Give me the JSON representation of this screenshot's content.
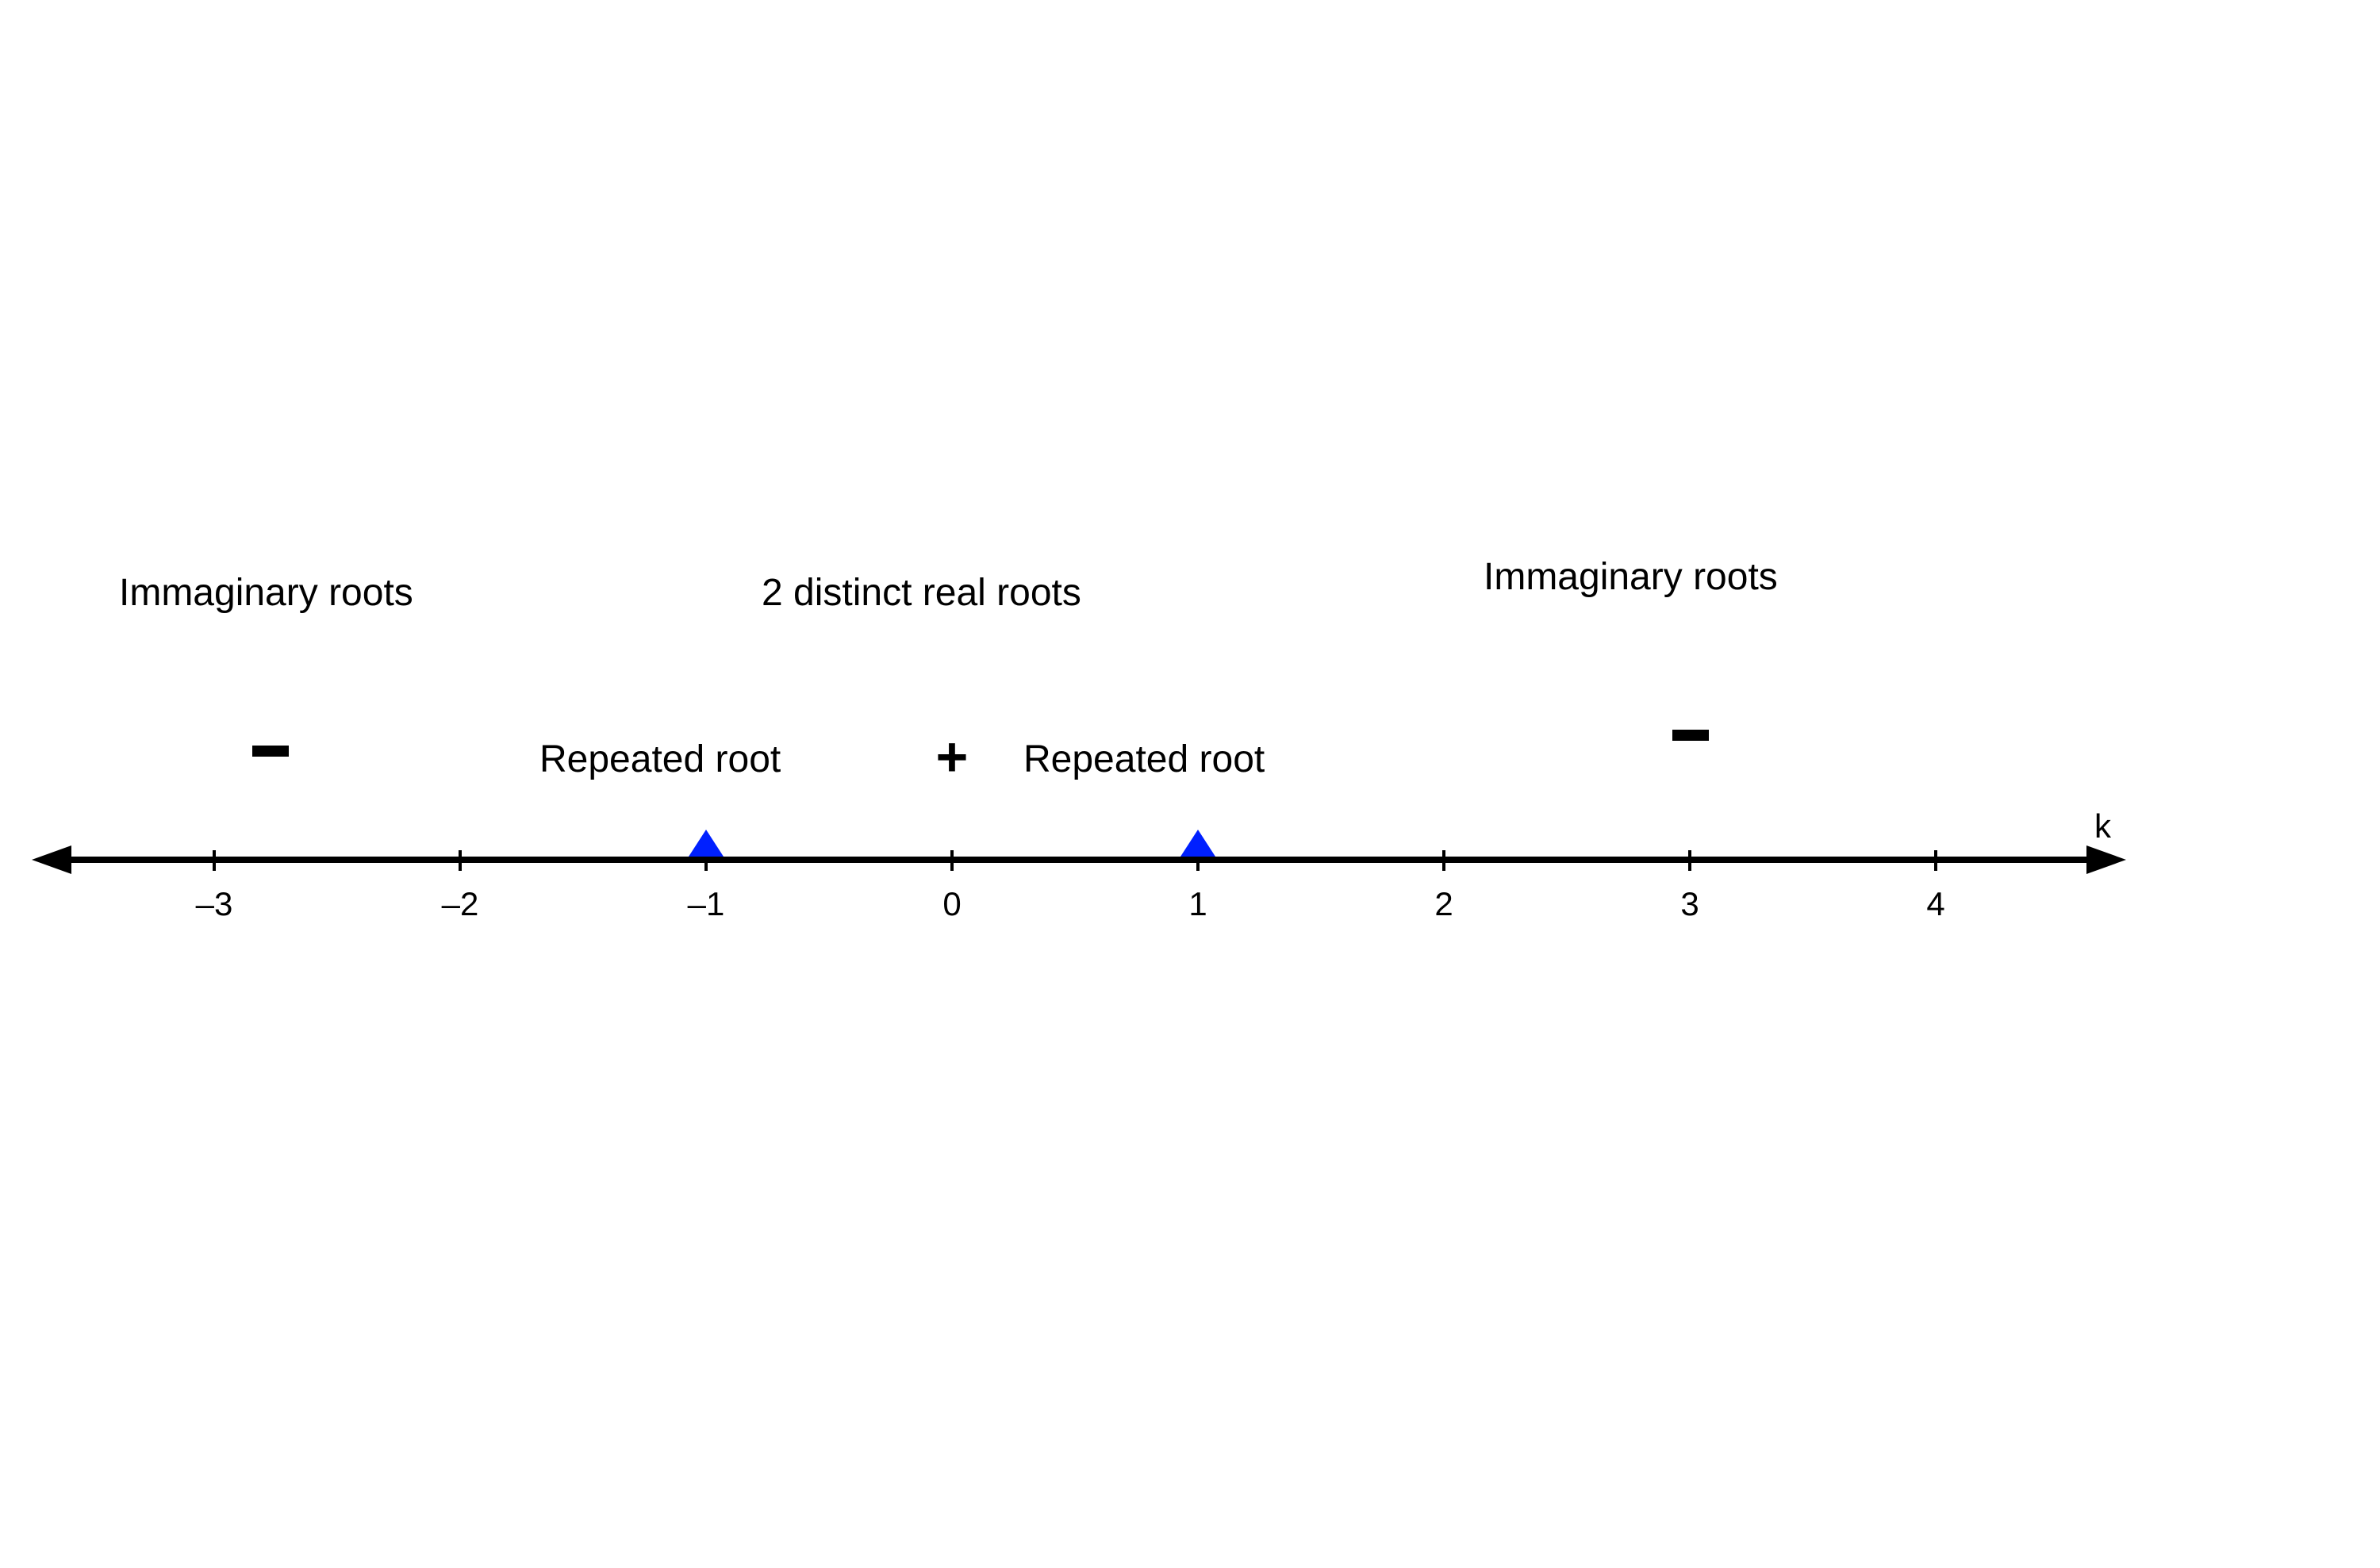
{
  "axis": {
    "label": "k",
    "ticks": [
      {
        "value": "–3"
      },
      {
        "value": "–2"
      },
      {
        "value": "–1"
      },
      {
        "value": "0"
      },
      {
        "value": "1"
      },
      {
        "value": "2"
      },
      {
        "value": "3"
      },
      {
        "value": "4"
      }
    ]
  },
  "markers": {
    "left": -1,
    "right": 1
  },
  "annotations": {
    "imaginary_left": "Immaginary roots",
    "imaginary_right": "Immaginary roots",
    "two_distinct": "2 distinct real roots",
    "repeated_left": "Repeated root",
    "repeated_right": "Repeated root"
  },
  "signs": {
    "minus_left": "-",
    "plus_center": "+",
    "minus_right": "-"
  }
}
